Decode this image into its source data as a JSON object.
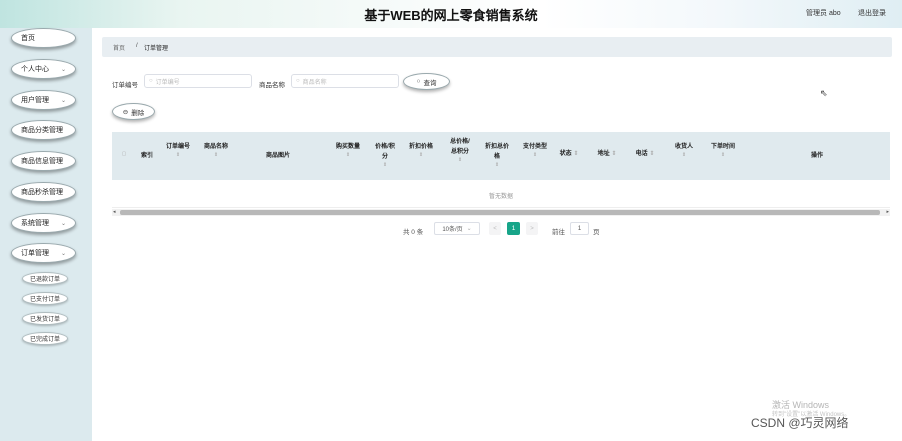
{
  "header": {
    "title": "基于WEB的网上零食销售系统",
    "admin": "管理员 abo",
    "logout": "退出登录"
  },
  "sidebar": {
    "items": [
      {
        "label": "首页",
        "chevron": false
      },
      {
        "label": "个人中心",
        "chevron": true
      },
      {
        "label": "用户管理",
        "chevron": true
      },
      {
        "label": "商品分类管理",
        "chevron": false
      },
      {
        "label": "商品信息管理",
        "chevron": false
      },
      {
        "label": "商品秒杀管理",
        "chevron": false
      },
      {
        "label": "系统管理",
        "chevron": true
      },
      {
        "label": "订单管理",
        "chevron": true
      }
    ],
    "sub_items": [
      {
        "label": "已退款订单"
      },
      {
        "label": "已支付订单"
      },
      {
        "label": "已发货订单"
      },
      {
        "label": "已完成订单"
      }
    ],
    "chevron_glyph": "⌄"
  },
  "breadcrumb": {
    "home": "首页",
    "separator": "/",
    "current": "订单管理"
  },
  "search": {
    "order_no_label": "订单编号",
    "order_no_placeholder": "订单编号",
    "product_name_label": "商品名称",
    "product_name_placeholder": "商品名称",
    "search_button": "查询",
    "delete_button": "删除"
  },
  "table": {
    "columns": [
      {
        "label": "索引",
        "label2": ""
      },
      {
        "label": "订单编号",
        "label2": ""
      },
      {
        "label": "商品名称",
        "label2": ""
      },
      {
        "label": "商品图片",
        "label2": ""
      },
      {
        "label": "购买数量",
        "label2": ""
      },
      {
        "label": "价格/积",
        "label2": "分"
      },
      {
        "label": "折扣价格",
        "label2": ""
      },
      {
        "label": "总价格/",
        "label2": "总积分"
      },
      {
        "label": "折扣总价",
        "label2": "格"
      },
      {
        "label": "支付类型",
        "label2": ""
      },
      {
        "label": "状态",
        "label2": ""
      },
      {
        "label": "地址",
        "label2": ""
      },
      {
        "label": "电话",
        "label2": ""
      },
      {
        "label": "收货人",
        "label2": ""
      },
      {
        "label": "下单时间",
        "label2": ""
      },
      {
        "label": "操作",
        "label2": ""
      }
    ],
    "empty_text": "暂无数据"
  },
  "pagination": {
    "total": "共 0 条",
    "page_size": "10条/页",
    "prev": "<",
    "current_page": "1",
    "next": ">",
    "goto_label": "前往",
    "goto_value": "1",
    "page_unit": "页"
  },
  "watermarks": {
    "windows": "激活 Windows",
    "windows_sub": "转到\"设置\"以激活 Windows。",
    "csdn": "CSDN @巧灵网络"
  },
  "colors": {
    "accent": "#17a589",
    "sidebar_bg": "#dceaee",
    "table_header_bg": "#e0eaee"
  }
}
